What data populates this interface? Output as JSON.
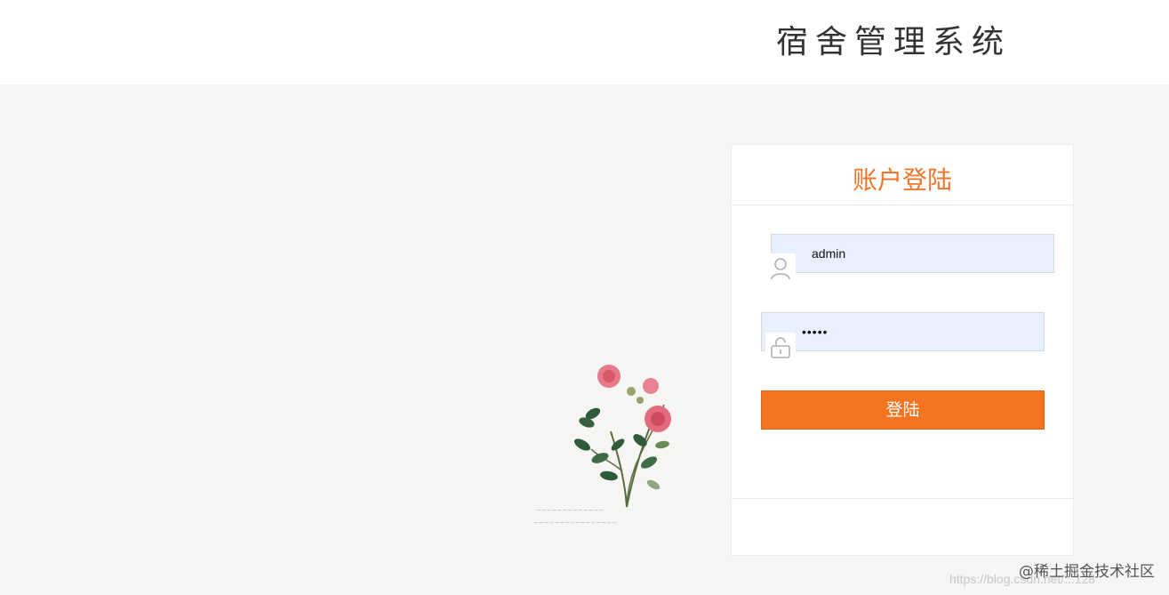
{
  "header": {
    "title": "宿舍管理系统"
  },
  "login": {
    "title": "账户登陆",
    "username": {
      "value": "admin",
      "icon": "user-icon"
    },
    "password": {
      "value": "•••••",
      "icon": "lock-icon"
    },
    "submit_label": "登陆"
  },
  "watermark": {
    "text": "@稀土掘金技术社区",
    "url": "https://blog.csdn.net/...128"
  },
  "colors": {
    "accent": "#f47421",
    "title_color": "#f0752b",
    "input_bg": "#e8f0fe",
    "page_bg": "#f6f5f3"
  }
}
